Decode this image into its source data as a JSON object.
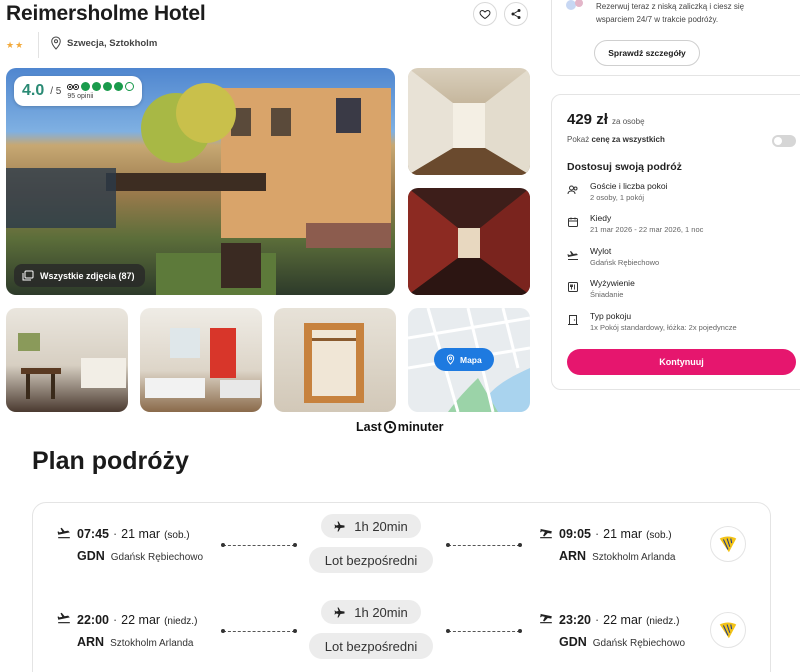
{
  "hotel": {
    "name": "Reimersholme Hotel",
    "stars": "★★",
    "location": "Szwecja, Sztokholm",
    "rating": "4.0",
    "rating_of": "/ 5",
    "reviews": "95 opinii",
    "all_photos": "Wszystkie zdjęcia (87)",
    "map_label": "Mapa"
  },
  "brand": {
    "logo_left": "Last",
    "logo_right": "minuter"
  },
  "promo": {
    "text_line1": "Rezerwuj teraz z niską zaliczką i ciesz się",
    "text_line2": "wsparciem 24/7 w trakcie podróży.",
    "button": "Sprawdź szczegóły"
  },
  "booking": {
    "price": "429 zł",
    "price_unit": "za osobę",
    "show_total_prefix": "Pokaż ",
    "show_total_bold": "cenę za wszystkich",
    "section_title": "Dostosuj swoją podróż",
    "options": [
      {
        "label": "Goście i liczba pokoi",
        "value": "2 osoby, 1 pokój",
        "icon": "guests-icon",
        "chevron": false
      },
      {
        "label": "Kiedy",
        "value": "21 mar 2026 - 22 mar 2026, 1 noc",
        "icon": "calendar-icon",
        "chevron": false
      },
      {
        "label": "Wylot",
        "value": "Gdańsk Rębiechowo",
        "icon": "plane-icon",
        "chevron": true
      },
      {
        "label": "Wyżywienie",
        "value": "Śniadanie",
        "icon": "meal-icon",
        "chevron": true
      },
      {
        "label": "Typ pokoju",
        "value": "1x Pokój standardowy, łóżka: 2x pojedyncze",
        "icon": "door-icon",
        "chevron": true
      }
    ],
    "continue": "Kontynuuj"
  },
  "plan": {
    "title": "Plan podróży",
    "legs": [
      {
        "dep_time": "07:45",
        "dep_date": "21 mar",
        "dep_day": "(sob.)",
        "dep_code": "GDN",
        "dep_name": "Gdańsk Rębiechowo",
        "duration": "1h 20min",
        "type": "Lot bezpośredni",
        "arr_time": "09:05",
        "arr_date": "21 mar",
        "arr_day": "(sob.)",
        "arr_code": "ARN",
        "arr_name": "Sztokholm Arlanda"
      },
      {
        "dep_time": "22:00",
        "dep_date": "22 mar",
        "dep_day": "(niedz.)",
        "dep_code": "ARN",
        "dep_name": "Sztokholm Arlanda",
        "duration": "1h 20min",
        "type": "Lot bezpośredni",
        "arr_time": "23:20",
        "arr_date": "22 mar",
        "arr_day": "(niedz.)",
        "arr_code": "GDN",
        "arr_name": "Gdańsk Rębiechowo"
      }
    ]
  },
  "colors": {
    "accent": "#e6166e",
    "rating_green": "#1a9b4c",
    "map_blue": "#1e7ae0",
    "star": "#f2a93b"
  }
}
